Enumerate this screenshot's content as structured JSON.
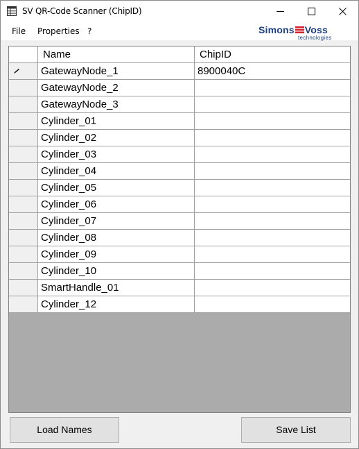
{
  "window": {
    "title": "SV QR-Code Scanner (ChipID)"
  },
  "menu": {
    "items": [
      "File",
      "Properties",
      "?"
    ]
  },
  "logo": {
    "brand_left": "Simons",
    "brand_right": "Voss",
    "tagline": "technologies",
    "colors": {
      "blue": "#1b3f7f",
      "red": "#d1222b"
    }
  },
  "grid": {
    "columns": [
      "Name",
      "ChipID"
    ],
    "rows": [
      {
        "name": "GatewayNode_1",
        "chip": "8900040C",
        "editing": true
      },
      {
        "name": "GatewayNode_2",
        "chip": ""
      },
      {
        "name": "GatewayNode_3",
        "chip": ""
      },
      {
        "name": "Cylinder_01",
        "chip": ""
      },
      {
        "name": "Cylinder_02",
        "chip": ""
      },
      {
        "name": "Cylinder_03",
        "chip": ""
      },
      {
        "name": "Cylinder_04",
        "chip": ""
      },
      {
        "name": "Cylinder_05",
        "chip": ""
      },
      {
        "name": "Cylinder_06",
        "chip": ""
      },
      {
        "name": "Cylinder_07",
        "chip": ""
      },
      {
        "name": "Cylinder_08",
        "chip": ""
      },
      {
        "name": "Cylinder_09",
        "chip": ""
      },
      {
        "name": "Cylinder_10",
        "chip": ""
      },
      {
        "name": "SmartHandle_01",
        "chip": ""
      },
      {
        "name": "Cylinder_12",
        "chip": ""
      }
    ]
  },
  "buttons": {
    "load": "Load Names",
    "save": "Save List"
  }
}
